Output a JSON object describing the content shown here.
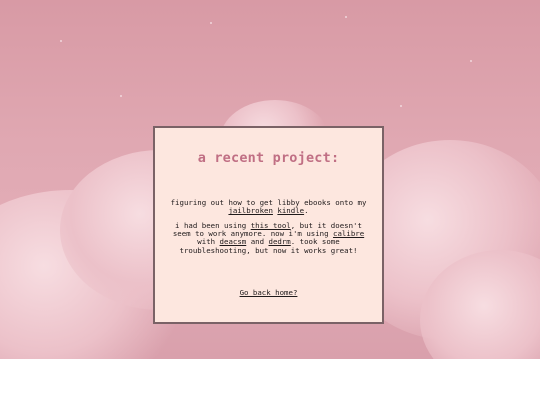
{
  "card": {
    "title": "a recent project:",
    "paragraph1": {
      "text_before": "figuring out how to get libby ebooks onto my ",
      "link_jailbroken": "jailbroken",
      "link_kindle": "kindle",
      "text_after": "."
    },
    "paragraph2": {
      "text_1": "i had been using ",
      "link_this_tool": "this tool",
      "text_2": ", but it doesn't seem to work anymore. now i'm using ",
      "link_calibre": "calibre",
      "text_3": " with ",
      "link_deacsm": "deacsm",
      "text_4": " and ",
      "link_dedrm": "dedrm",
      "text_5": ". took some troubleshooting, but now it works great!"
    },
    "back_link": "Go back home?"
  },
  "colors": {
    "background_sky": "#e0a8b2",
    "card_background": "#fde7df",
    "card_border": "#7a6266",
    "title": "#c06f84",
    "text": "#1f1a1b"
  }
}
